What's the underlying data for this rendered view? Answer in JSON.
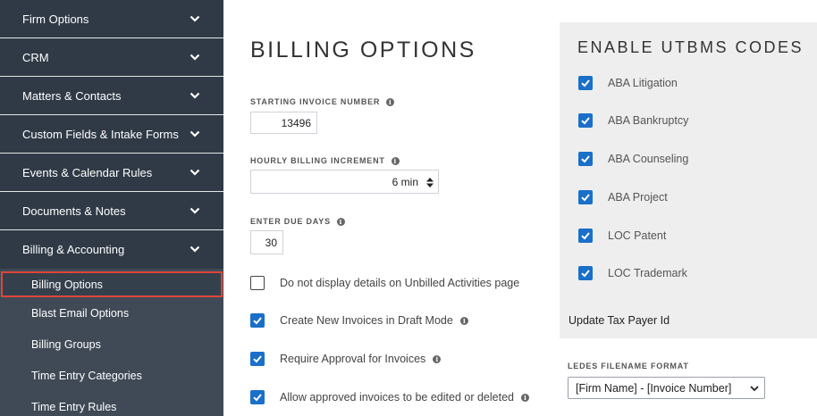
{
  "sidebar": {
    "sections": [
      {
        "label": "Firm Options"
      },
      {
        "label": "CRM"
      },
      {
        "label": "Matters & Contacts"
      },
      {
        "label": "Custom Fields & Intake Forms"
      },
      {
        "label": "Events & Calendar Rules"
      },
      {
        "label": "Documents & Notes"
      },
      {
        "label": "Billing & Accounting"
      }
    ],
    "subitems": [
      {
        "label": "Billing Options",
        "active": true
      },
      {
        "label": "Blast Email Options"
      },
      {
        "label": "Billing Groups"
      },
      {
        "label": "Time Entry Categories"
      },
      {
        "label": "Time Entry Rules"
      }
    ]
  },
  "main": {
    "title": "BILLING OPTIONS",
    "starting_invoice": {
      "label": "STARTING INVOICE NUMBER",
      "value": "13496"
    },
    "hourly_increment": {
      "label": "HOURLY BILLING INCREMENT",
      "value": "6 min"
    },
    "due_days": {
      "label": "ENTER DUE DAYS",
      "value": "30"
    },
    "checkboxes": [
      {
        "label": "Do not display details on Unbilled Activities page",
        "checked": false,
        "info": false
      },
      {
        "label": "Create New Invoices in Draft Mode",
        "checked": true,
        "info": true
      },
      {
        "label": "Require Approval for Invoices",
        "checked": true,
        "info": true
      },
      {
        "label": "Allow approved invoices to be edited or deleted",
        "checked": true,
        "info": true
      }
    ]
  },
  "utbms": {
    "title": "ENABLE UTBMS CODES",
    "codes": [
      {
        "label": "ABA Litigation",
        "checked": true
      },
      {
        "label": "ABA Bankruptcy",
        "checked": true
      },
      {
        "label": "ABA Counseling",
        "checked": true
      },
      {
        "label": "ABA Project",
        "checked": true
      },
      {
        "label": "LOC Patent",
        "checked": true
      },
      {
        "label": "LOC Trademark",
        "checked": true
      }
    ],
    "tax_payer_link": "Update Tax Payer Id"
  },
  "ledes": {
    "label": "LEDES FILENAME FORMAT",
    "selected": "[Firm Name] - [Invoice Number]"
  },
  "icons": {
    "info": "i"
  },
  "colors": {
    "sidebar": "#2f3a46",
    "checkbox": "#1a6fc9",
    "active_outline": "#e0453a"
  }
}
